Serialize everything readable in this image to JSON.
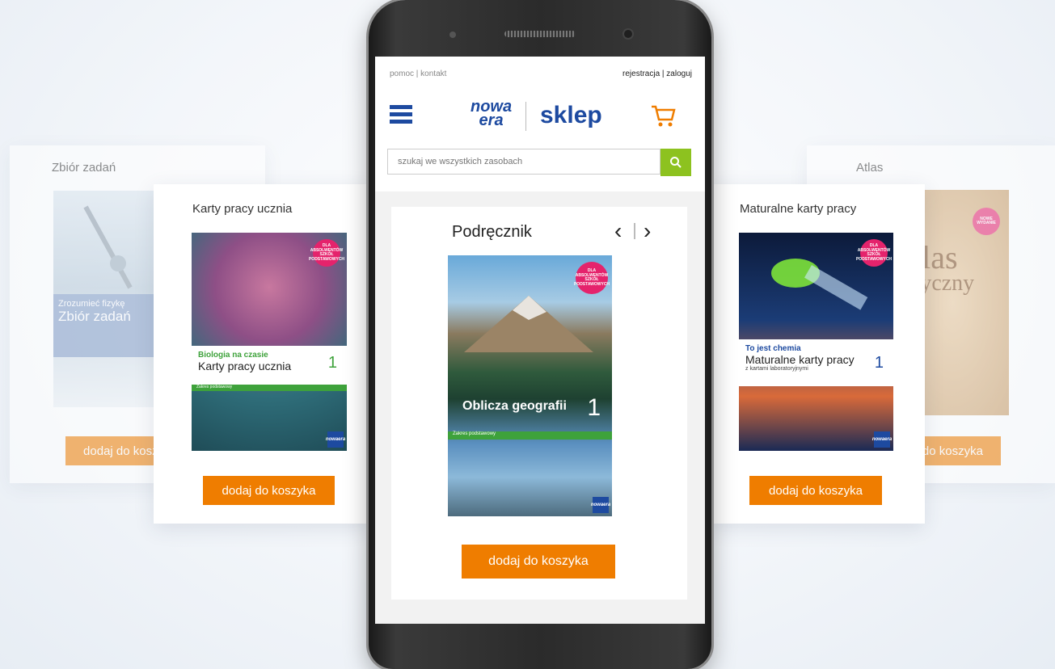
{
  "cards": {
    "far_left": {
      "title": "Zbiór zadań",
      "button": "dodaj do koszyka",
      "cover_series": "Zrozumieć fizykę",
      "cover_title": "Zbiór zadań"
    },
    "left": {
      "title": "Karty pracy ucznia",
      "button": "dodaj do koszyka",
      "cover_series": "Biologia na czasie",
      "cover_title": "Karty pracy ucznia",
      "cover_number": "1",
      "cover_level": "Zakres podstawowy"
    },
    "right": {
      "title": "Maturalne karty pracy",
      "button": "dodaj do koszyka",
      "cover_series": "To jest chemia",
      "cover_title": "Maturalne karty pracy",
      "cover_subtitle": "z kartami laboratoryjnymi",
      "cover_number": "1"
    },
    "far_right": {
      "title": "Atlas",
      "button": "dodaj do koszyka",
      "cover_badge": "NOWE WYDANIE",
      "cover_title_part1": "tlas",
      "cover_title_part2": "ryczny"
    }
  },
  "phone": {
    "top_links_left": "pomoc | kontakt",
    "top_links_right": "rejestracja | zaloguj",
    "logo_brand_line1": "nowa",
    "logo_brand_line2": "era",
    "logo_shop": "sklep",
    "search_placeholder": "szukaj we wszystkich zasobach",
    "product": {
      "category": "Podręcznik",
      "prev": "‹",
      "next": "›",
      "cover_title": "Oblicza geografii",
      "cover_number": "1",
      "cover_level": "Zakres podstawowy",
      "cover_badge": "DLA ABSOLWENTÓW SZKÓŁ PODSTAWOWYCH",
      "button": "dodaj do koszyka"
    }
  },
  "badge_text": "DLA ABSOLWENTÓW SZKÓŁ PODSTAWOWYCH",
  "logo_mini_line1": "nowa",
  "logo_mini_line2": "era",
  "colors": {
    "accent_orange": "#ef7d00",
    "brand_blue": "#1d4aa0",
    "search_green": "#8dc21f"
  }
}
